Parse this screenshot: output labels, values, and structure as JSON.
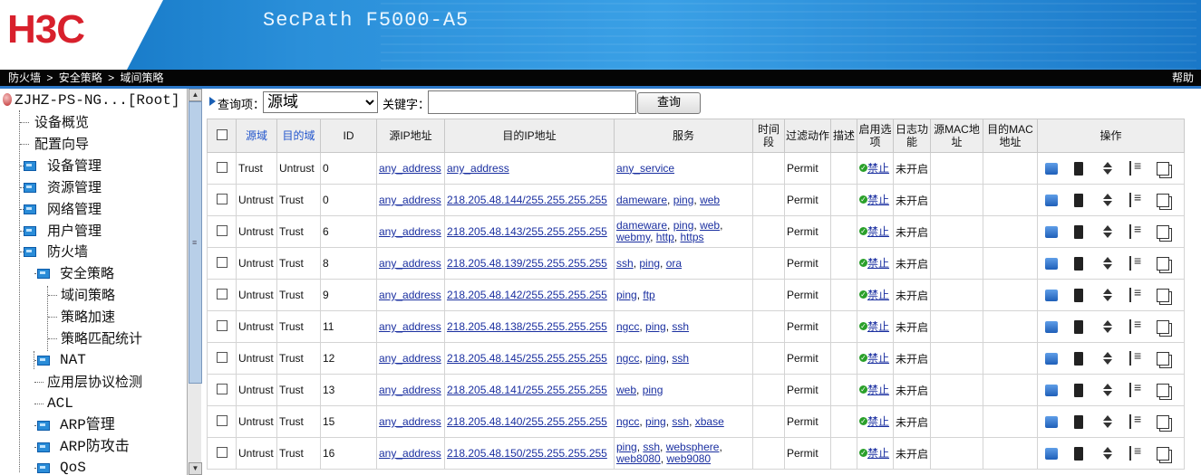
{
  "banner": {
    "logo": "H3C",
    "product": "SecPath F5000-A5"
  },
  "pathbar": {
    "crumbs": [
      "防火墙",
      ">",
      "安全策略",
      ">",
      "域间策略"
    ],
    "help": "帮助"
  },
  "sidebar": {
    "root": "ZJHZ-PS-NG...[Root]",
    "items": [
      {
        "label": "设备概览",
        "folder": false
      },
      {
        "label": "配置向导",
        "folder": false
      },
      {
        "label": "设备管理",
        "folder": true
      },
      {
        "label": "资源管理",
        "folder": true
      },
      {
        "label": "网络管理",
        "folder": true
      },
      {
        "label": "用户管理",
        "folder": true
      },
      {
        "label": "防火墙",
        "folder": true
      },
      {
        "label": "安全策略",
        "folder": true
      },
      {
        "label": "域间策略",
        "folder": false
      },
      {
        "label": "策略加速",
        "folder": false
      },
      {
        "label": "策略匹配统计",
        "folder": false
      },
      {
        "label": "NAT",
        "folder": true
      },
      {
        "label": "应用层协议检测",
        "folder": false
      },
      {
        "label": "ACL",
        "folder": false
      },
      {
        "label": "ARP管理",
        "folder": true
      },
      {
        "label": "ARP防攻击",
        "folder": true
      },
      {
        "label": "QoS",
        "folder": true
      }
    ]
  },
  "query": {
    "item_label": "查询项：",
    "selected": "源域",
    "keyword_label": "关键字：",
    "keyword_value": "",
    "button": "查询"
  },
  "table": {
    "headers": {
      "src_zone": "源域",
      "dst_zone": "目的域",
      "id": "ID",
      "src_ip": "源IP地址",
      "dst_ip": "目的IP地址",
      "service": "服务",
      "time": "时间段",
      "filter": "过滤动作",
      "desc": "描述",
      "enable": "启用选项",
      "log": "日志功能",
      "src_mac": "源MAC地址",
      "dst_mac": "目的MAC地址",
      "ops": "操作"
    },
    "rows": [
      {
        "src": "Trust",
        "dst": "Untrust",
        "id": "0",
        "srcip": "any_address",
        "dstip": "any_address",
        "services": [
          "any_service"
        ],
        "action": "Permit",
        "enable": "禁止",
        "log": "未开启"
      },
      {
        "src": "Untrust",
        "dst": "Trust",
        "id": "0",
        "srcip": "any_address",
        "dstip": "218.205.48.144/255.255.255.255",
        "services": [
          "dameware",
          "ping",
          "web"
        ],
        "action": "Permit",
        "enable": "禁止",
        "log": "未开启"
      },
      {
        "src": "Untrust",
        "dst": "Trust",
        "id": "6",
        "srcip": "any_address",
        "dstip": "218.205.48.143/255.255.255.255",
        "services": [
          "dameware",
          "ping",
          "web",
          "webmy",
          "http",
          "https"
        ],
        "action": "Permit",
        "enable": "禁止",
        "log": "未开启"
      },
      {
        "src": "Untrust",
        "dst": "Trust",
        "id": "8",
        "srcip": "any_address",
        "dstip": "218.205.48.139/255.255.255.255",
        "services": [
          "ssh",
          "ping",
          "ora"
        ],
        "action": "Permit",
        "enable": "禁止",
        "log": "未开启"
      },
      {
        "src": "Untrust",
        "dst": "Trust",
        "id": "9",
        "srcip": "any_address",
        "dstip": "218.205.48.142/255.255.255.255",
        "services": [
          "ping",
          "ftp"
        ],
        "action": "Permit",
        "enable": "禁止",
        "log": "未开启"
      },
      {
        "src": "Untrust",
        "dst": "Trust",
        "id": "11",
        "srcip": "any_address",
        "dstip": "218.205.48.138/255.255.255.255",
        "services": [
          "ngcc",
          "ping",
          "ssh"
        ],
        "action": "Permit",
        "enable": "禁止",
        "log": "未开启"
      },
      {
        "src": "Untrust",
        "dst": "Trust",
        "id": "12",
        "srcip": "any_address",
        "dstip": "218.205.48.145/255.255.255.255",
        "services": [
          "ngcc",
          "ping",
          "ssh"
        ],
        "action": "Permit",
        "enable": "禁止",
        "log": "未开启"
      },
      {
        "src": "Untrust",
        "dst": "Trust",
        "id": "13",
        "srcip": "any_address",
        "dstip": "218.205.48.141/255.255.255.255",
        "services": [
          "web",
          "ping"
        ],
        "action": "Permit",
        "enable": "禁止",
        "log": "未开启"
      },
      {
        "src": "Untrust",
        "dst": "Trust",
        "id": "15",
        "srcip": "any_address",
        "dstip": "218.205.48.140/255.255.255.255",
        "services": [
          "ngcc",
          "ping",
          "ssh",
          "xbase"
        ],
        "action": "Permit",
        "enable": "禁止",
        "log": "未开启"
      },
      {
        "src": "Untrust",
        "dst": "Trust",
        "id": "16",
        "srcip": "any_address",
        "dstip": "218.205.48.150/255.255.255.255",
        "services": [
          "ping",
          "ssh",
          "websphere",
          "web8080",
          "web9080"
        ],
        "action": "Permit",
        "enable": "禁止",
        "log": "未开启"
      }
    ]
  }
}
